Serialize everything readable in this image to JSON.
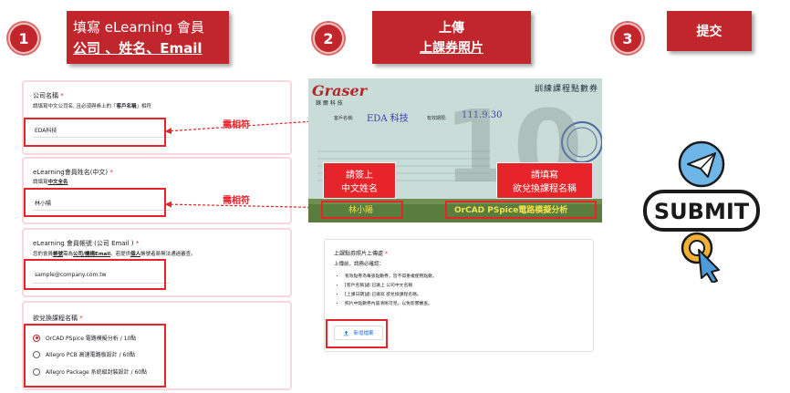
{
  "steps": [
    {
      "number": "1",
      "line1": "填寫 eLearning 會員",
      "line2": "公司 、姓名、Email"
    },
    {
      "number": "2",
      "line1": "上傳",
      "line2": "上課券照片"
    },
    {
      "number": "3",
      "line1": "提交"
    }
  ],
  "form": {
    "company": {
      "title": "公司名稱",
      "required": "*",
      "desc_prefix": "請填寫中文公司名, 且必須與券上的「",
      "desc_bold": "客戶名稱",
      "desc_suffix": "」相符",
      "value": "EDA科技"
    },
    "name": {
      "title": "eLearning會員姓名(中文)",
      "required": "*",
      "desc_prefix": "請填寫",
      "desc_bold": "中文全名",
      "value": "林小陽"
    },
    "email": {
      "title": "eLearning 會員帳號 (公司 Email )",
      "required": "*",
      "desc_prefix": "您的會員",
      "desc_bold1": "帳號",
      "desc_mid1": "需為",
      "desc_bold2": "公司/機構Email",
      "desc_mid2": "。若提供",
      "desc_bold3": "個人",
      "desc_suffix": "帳號者將無法通過審查。",
      "value": "sample@company.com.tw"
    },
    "course": {
      "title": "欲兌換課程名稱",
      "required": "*",
      "options": [
        {
          "label": "OrCAD PSpice 電路模擬分析 / 10點",
          "checked": true
        },
        {
          "label": "Allegro PCB 高速電路板設計 / 60點",
          "checked": false
        },
        {
          "label": "Allegro Package 系統級封裝設計 / 60點",
          "checked": false
        }
      ]
    }
  },
  "notes": {
    "must_match_1": "需相符",
    "must_match_2": "需相符"
  },
  "voucher": {
    "brand": "Graser",
    "brand_sub": "鎵 爾 科 技",
    "title": "訓練課程點數券",
    "customer_label": "客戶名稱:",
    "customer_value": "EDA 科技",
    "date_label": "有效期限:",
    "date_value": "111.9.30",
    "big_number": "10",
    "callout_left_1": "請簽上",
    "callout_left_2": "中文姓名",
    "callout_right_1": "請填寫",
    "callout_right_2": "欲兌換課程名稱",
    "signature": "林小陽",
    "course_written": "OrCAD PSpice電路模擬分析"
  },
  "upload": {
    "title": "上課點券照片上傳處",
    "required": "*",
    "desc": "上傳前，請務必確認：",
    "items": [
      "有效點券為每張點數券，皆不得重複使用點數。",
      "[客戶名稱]處:已填上 公司中文名稱",
      "[上課日期]處:已填寫 欲兌換課程名稱。",
      "照片中點數券內容清晰可見，以免影響審查。"
    ],
    "button_label": "新增檔案",
    "button_icon": "upload-icon"
  },
  "submit_graphic": {
    "label": "SUBMIT",
    "icons": [
      "paper-plane-icon",
      "cursor-click-icon"
    ],
    "colors": {
      "plane_circle": "#6fb6e8",
      "ring": "#f2b134",
      "cursor": "#4a9bd8"
    }
  },
  "colors": {
    "accent": "#c0262c",
    "highlight": "#e8242b",
    "card_border": "#f7d9dd"
  }
}
